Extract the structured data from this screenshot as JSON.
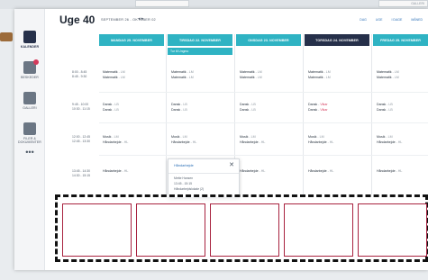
{
  "backdrop": {
    "galleri": "GALLERI"
  },
  "sidebar": {
    "items": [
      {
        "label": "KALENDER"
      },
      {
        "label": "BESKEDER"
      },
      {
        "label": "GALLERI"
      },
      {
        "label": "FILER & DOKUMENTER"
      }
    ],
    "more": "•••"
  },
  "header": {
    "title": "Uge 40",
    "range": "SEPTEMBER 26 - OKTOBER 02",
    "nav": "◂ ▸",
    "links": [
      "DAG",
      "UGE",
      "I DAGE",
      "MÅNED"
    ]
  },
  "days": [
    {
      "label": "MANDAG 25. NOVEMBER"
    },
    {
      "label": "TIRSDAG 22. NOVEMBER"
    },
    {
      "label": "ONSDAG 23. NOVEMBER"
    },
    {
      "label": "TORSDAG 24. NOVEMBER"
    },
    {
      "label": "FREDAG 25. NOVEMBER"
    }
  ],
  "subchip": "Tur til Ungmo",
  "times": [
    [
      "8:00 - 8:45",
      "8:45 - 9:30"
    ],
    [
      "9:45 - 10:00",
      "10:30 - 11:15"
    ],
    [
      "12:00 - 12:45",
      "12:45 - 13:30"
    ],
    [
      "13:45 - 14:30",
      "14:30 - 15:15"
    ]
  ],
  "rows": [
    {
      "subject": "Matematik",
      "teacher": "LM"
    },
    {
      "subject": "Matematik",
      "teacher": "LM"
    },
    {
      "subject": "Dansk",
      "teacher": "LB"
    },
    {
      "subject": "Dansk",
      "teacher": "LB"
    },
    {
      "subject": "Musik",
      "teacher": "LM"
    },
    {
      "subject": "Håndarbejde",
      "teacher": "HL"
    },
    {
      "subject": "Håndarbejde",
      "teacher": "HL"
    }
  ],
  "thursday_teacher": "Vikar",
  "popup": {
    "title": "Håndarbejde",
    "close": "✕",
    "lines": [
      "Mette Hansen",
      "13:45 - 15:15",
      "Håndarbejdslokale (2)"
    ]
  }
}
